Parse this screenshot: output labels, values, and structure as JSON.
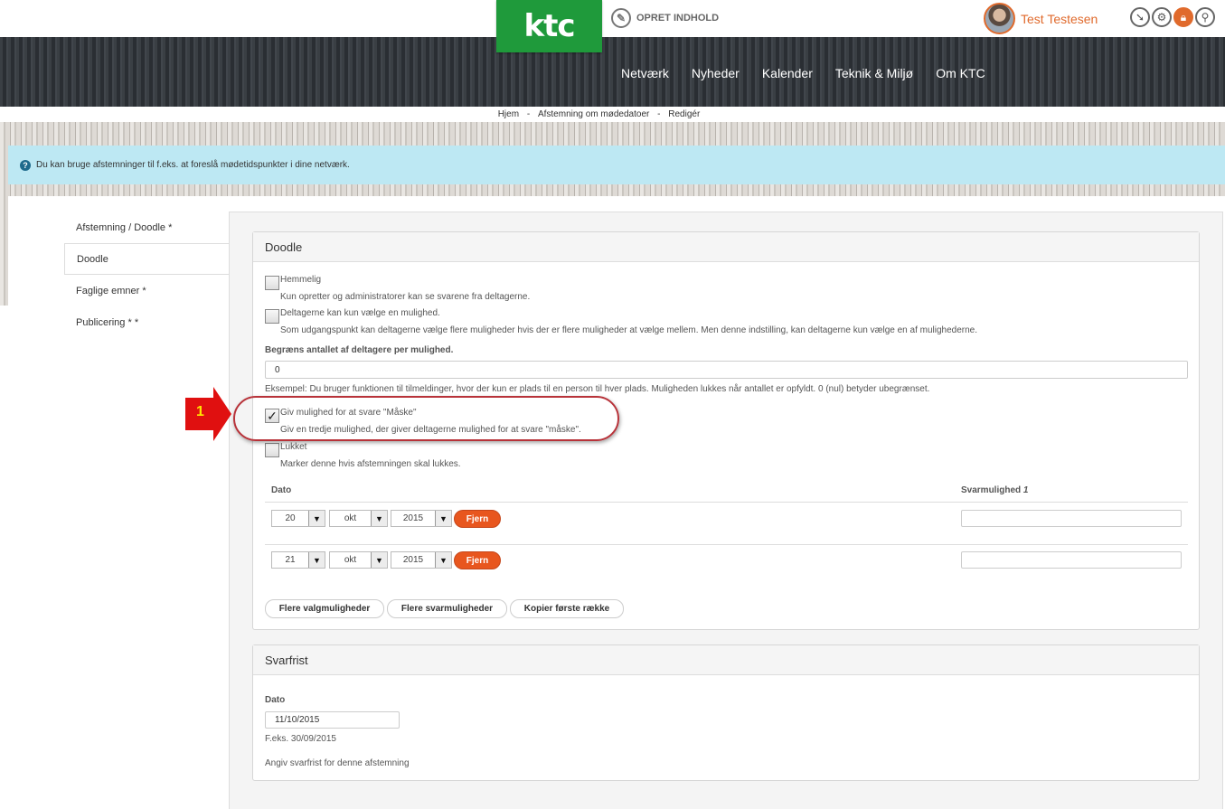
{
  "header": {
    "logo": "ktc",
    "create_label": "OPRET INDHOLD",
    "user_name": "Test Testesen",
    "tool_icons": [
      "pin-icon",
      "gear-icon",
      "lock-icon",
      "search-icon"
    ]
  },
  "nav": [
    "Netværk",
    "Nyheder",
    "Kalender",
    "Teknik & Miljø",
    "Om KTC"
  ],
  "breadcrumb": [
    "Hjem",
    "-",
    "Afstemning om mødedatoer",
    "-",
    "Redigér"
  ],
  "info": "Du kan bruge afstemninger til f.eks. at foreslå mødetidspunkter i dine netværk.",
  "sidebar": [
    "Afstemning / Doodle *",
    "Doodle",
    "Faglige emner *",
    "Publicering * *"
  ],
  "doodle": {
    "title": "Doodle",
    "secret_label": "Hemmelig",
    "secret_help": "Kun opretter og administratorer kan se svarene fra deltagerne.",
    "single_label": "Deltagerne kan kun vælge en mulighed.",
    "single_help": "Som udgangspunkt kan deltagerne vælge flere muligheder hvis der er flere muligheder at vælge mellem. Men denne indstilling, kan deltagerne kun vælge en af mulighederne.",
    "limit_label": "Begræns antallet af deltagere per mulighed.",
    "limit_value": "0",
    "limit_help": "Eksempel: Du bruger funktionen til tilmeldinger, hvor der kun er plads til en person til hver plads. Muligheden lukkes når antallet er opfyldt. 0 (nul) betyder ubegrænset.",
    "maybe_label": "Giv mulighed for at svare \"Måske\"",
    "maybe_help": "Giv en tredje mulighed, der giver deltagerne mulighed for at svare \"måske\".",
    "maybe_checked": "✓",
    "closed_label": "Lukket",
    "closed_help": "Marker denne hvis afstemningen skal lukkes.",
    "col_date": "Dato",
    "col_answer": "Svarmulighed",
    "col_answer_num": "1",
    "rows": [
      {
        "day": "20",
        "month": "okt",
        "year": "2015",
        "remove": "Fjern",
        "answer": ""
      },
      {
        "day": "21",
        "month": "okt",
        "year": "2015",
        "remove": "Fjern",
        "answer": ""
      }
    ],
    "btn_more_options": "Flere valgmuligheder",
    "btn_more_answers": "Flere svarmuligheder",
    "btn_copy_first": "Kopier første række"
  },
  "deadline": {
    "title": "Svarfrist",
    "date_label": "Dato",
    "date_value": "11/10/2015",
    "example": "F.eks. 30/09/2015",
    "help": "Angiv svarfrist for denne afstemning"
  },
  "annotation": {
    "number": "1",
    "color": "#e01010"
  }
}
